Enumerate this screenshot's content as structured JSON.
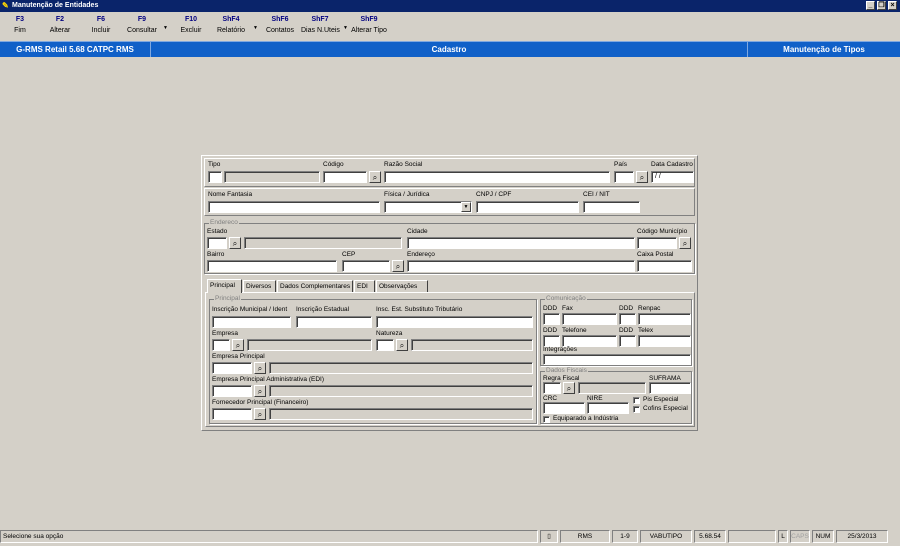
{
  "window": {
    "title": "Manutenção de Entidades"
  },
  "toolbar": {
    "buttons": [
      {
        "key": "F3",
        "label": "Fim"
      },
      {
        "key": "F2",
        "label": "Alterar"
      },
      {
        "key": "F6",
        "label": "Incluir"
      },
      {
        "key": "F9",
        "label": "Consultar"
      },
      {
        "key": "F10",
        "label": "Excluir"
      },
      {
        "key": "ShF4",
        "label": "Relatório"
      },
      {
        "key": "ShF6",
        "label": "Contatos"
      },
      {
        "key": "ShF7",
        "label": "Dias N.Uteis"
      },
      {
        "key": "ShF9",
        "label": "Alterar Tipo"
      }
    ]
  },
  "header": {
    "app": "G-RMS Retail 5.68 CATPC RMS",
    "section": "Cadastro",
    "context": "Manutenção de Tipos"
  },
  "form": {
    "tipo": "Tipo",
    "codigo": "Código",
    "razao_social": "Razão Social",
    "pais": "País",
    "data_cadastro": "Data Cadastro",
    "data_cadastro_value": " / /",
    "nome_fantasia": "Nome Fantasia",
    "fisica_juridica": "Física / Jurídica",
    "cnpj_cpf": "CNPJ / CPF",
    "cei_nit": "CEI / NIT",
    "endereco_group": "Endereco",
    "estado": "Estado",
    "cidade": "Cidade",
    "codigo_municipio": "Código Município",
    "bairro": "Bairro",
    "cep": "CEP",
    "endereco": "Endereço",
    "caixa_postal": "Caixa Postal"
  },
  "tabs": [
    "Principal",
    "Diversos",
    "Dados Complementares",
    "EDI",
    "Observações"
  ],
  "principal": {
    "group": "Principal",
    "inscricao_municipal": "Inscrição Municipal / Ident",
    "inscricao_estadual": "Inscrição Estadual",
    "insc_substituto": "Insc. Est. Substituto Tributário",
    "empresa": "Empresa",
    "natureza": "Natureza",
    "empresa_principal": "Empresa Principal",
    "empresa_principal_adm": "Empresa Principal Administrativa (EDI)",
    "fornecedor_principal": "Fornecedor Principal (Financeiro)"
  },
  "comunicacao": {
    "group": "Comunicação",
    "ddd1": "DDD",
    "fax": "Fax",
    "ddd2": "DDD",
    "renpac": "Renpac",
    "ddd3": "DDD",
    "telefone": "Telefone",
    "ddd4": "DDD",
    "telex": "Telex",
    "integracoes": "Integrações"
  },
  "fiscais": {
    "group": "Dados Fiscais",
    "regra_fiscal": "Regra Fiscal",
    "suframa": "SUFRAMA",
    "crc": "CRC",
    "nire": "NIRE",
    "pis": "Pis Especial",
    "cofins": "Cofins Especial",
    "equiparado": "Equiparado a Indústria"
  },
  "status": {
    "message": "Selecione sua opção",
    "system": "RMS",
    "page": "1-9",
    "program": "VABUTIPO",
    "version": "5.68.54",
    "l": "L",
    "caps": "CAPS",
    "num": "NUM",
    "date": "25/3/2013"
  }
}
